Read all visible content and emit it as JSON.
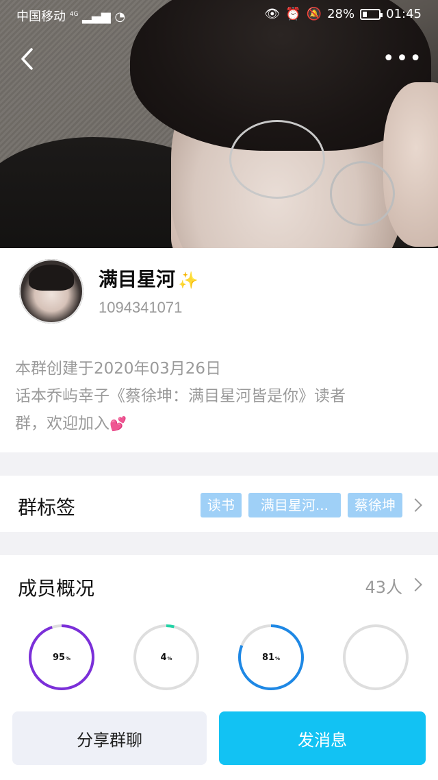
{
  "status_bar": {
    "carrier": "中国移动",
    "network": "4G",
    "battery": "28%",
    "time": "01:45"
  },
  "header": {
    "back_icon": "chevron-left-icon",
    "more_icon": "more-dots-icon",
    "more_label": "•••"
  },
  "group": {
    "name": "满目星河",
    "name_emoji": "✨",
    "id": "1094341071",
    "desc_line1": "本群创建于2020年03月26日",
    "desc_line2": "话本乔屿幸子《蔡徐坤：满目星河皆是你》读者",
    "desc_line3": "群，欢迎加入",
    "desc_emoji": "💕"
  },
  "tags_section": {
    "title": "群标签",
    "tags": [
      "读书",
      "满目星河...",
      "蔡徐坤"
    ]
  },
  "members_section": {
    "title": "成员概况",
    "count": "43人",
    "stats": [
      {
        "value": "95",
        "unit": "%",
        "percent": 95,
        "color": "#7b2fd9"
      },
      {
        "value": "4",
        "unit": "%",
        "percent": 4,
        "color": "#22d3a6"
      },
      {
        "value": "81",
        "unit": "%",
        "percent": 81,
        "color": "#1e88e5"
      },
      {
        "value": "",
        "unit": "",
        "percent": 0,
        "color": "#d9d9d9"
      }
    ]
  },
  "actions": {
    "share_label": "分享群聊",
    "send_label": "发消息"
  },
  "colors": {
    "accent": "#12c2f3",
    "tag_bg": "#9fd0f7",
    "ring_track": "#dedede"
  }
}
